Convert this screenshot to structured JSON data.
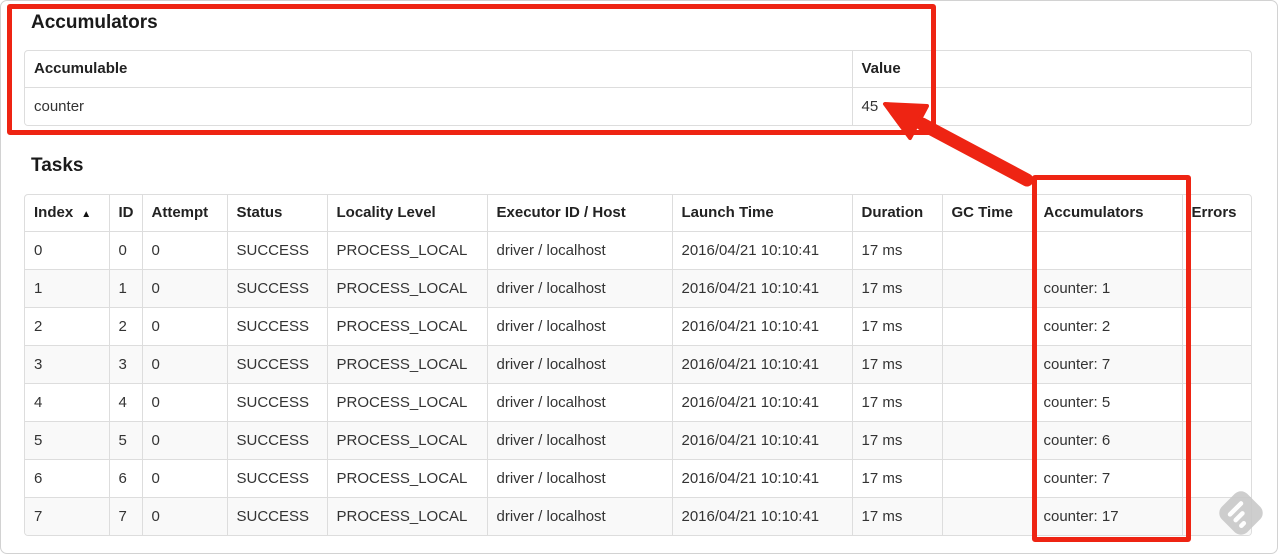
{
  "annotations": {
    "color": "#ee2413"
  },
  "accumulators_section": {
    "title": "Accumulators",
    "table": {
      "headers": {
        "accumulable": "Accumulable",
        "value": "Value"
      },
      "rows": [
        {
          "accumulable": "counter",
          "value": "45"
        }
      ]
    }
  },
  "tasks_section": {
    "title": "Tasks",
    "table": {
      "sort_icon": "▲",
      "headers": {
        "index": "Index",
        "id": "ID",
        "attempt": "Attempt",
        "status": "Status",
        "locality": "Locality Level",
        "executor": "Executor ID / Host",
        "launch": "Launch Time",
        "duration": "Duration",
        "gc": "GC Time",
        "accumulators": "Accumulators",
        "errors": "Errors"
      },
      "rows": [
        {
          "index": "0",
          "id": "0",
          "attempt": "0",
          "status": "SUCCESS",
          "locality": "PROCESS_LOCAL",
          "executor": "driver / localhost",
          "launch": "2016/04/21 10:10:41",
          "duration": "17 ms",
          "gc": "",
          "accumulators": "",
          "errors": ""
        },
        {
          "index": "1",
          "id": "1",
          "attempt": "0",
          "status": "SUCCESS",
          "locality": "PROCESS_LOCAL",
          "executor": "driver / localhost",
          "launch": "2016/04/21 10:10:41",
          "duration": "17 ms",
          "gc": "",
          "accumulators": "counter: 1",
          "errors": ""
        },
        {
          "index": "2",
          "id": "2",
          "attempt": "0",
          "status": "SUCCESS",
          "locality": "PROCESS_LOCAL",
          "executor": "driver / localhost",
          "launch": "2016/04/21 10:10:41",
          "duration": "17 ms",
          "gc": "",
          "accumulators": "counter: 2",
          "errors": ""
        },
        {
          "index": "3",
          "id": "3",
          "attempt": "0",
          "status": "SUCCESS",
          "locality": "PROCESS_LOCAL",
          "executor": "driver / localhost",
          "launch": "2016/04/21 10:10:41",
          "duration": "17 ms",
          "gc": "",
          "accumulators": "counter: 7",
          "errors": ""
        },
        {
          "index": "4",
          "id": "4",
          "attempt": "0",
          "status": "SUCCESS",
          "locality": "PROCESS_LOCAL",
          "executor": "driver / localhost",
          "launch": "2016/04/21 10:10:41",
          "duration": "17 ms",
          "gc": "",
          "accumulators": "counter: 5",
          "errors": ""
        },
        {
          "index": "5",
          "id": "5",
          "attempt": "0",
          "status": "SUCCESS",
          "locality": "PROCESS_LOCAL",
          "executor": "driver / localhost",
          "launch": "2016/04/21 10:10:41",
          "duration": "17 ms",
          "gc": "",
          "accumulators": "counter: 6",
          "errors": ""
        },
        {
          "index": "6",
          "id": "6",
          "attempt": "0",
          "status": "SUCCESS",
          "locality": "PROCESS_LOCAL",
          "executor": "driver / localhost",
          "launch": "2016/04/21 10:10:41",
          "duration": "17 ms",
          "gc": "",
          "accumulators": "counter: 7",
          "errors": ""
        },
        {
          "index": "7",
          "id": "7",
          "attempt": "0",
          "status": "SUCCESS",
          "locality": "PROCESS_LOCAL",
          "executor": "driver / localhost",
          "launch": "2016/04/21 10:10:41",
          "duration": "17 ms",
          "gc": "",
          "accumulators": "counter: 17",
          "errors": ""
        }
      ]
    }
  }
}
